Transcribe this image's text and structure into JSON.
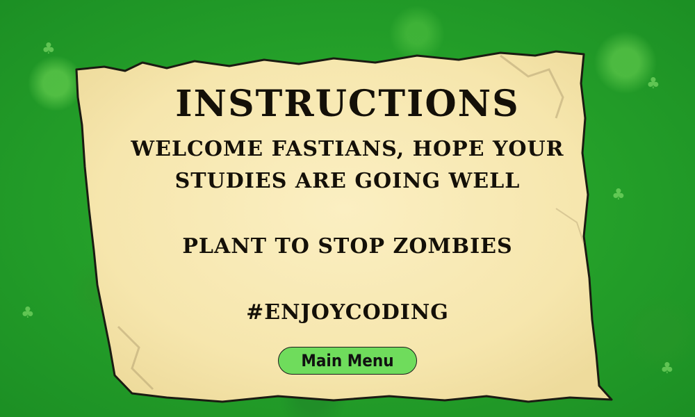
{
  "screen": {
    "title": "INSTRUCTIONS",
    "welcome_line_1": "WELCOME FASTIANS, HOPE YOUR",
    "welcome_line_2": "STUDIES ARE GOING WELL",
    "instruction": "PLANT TO STOP ZOMBIES",
    "hashtag": "#ENJOYCODING"
  },
  "buttons": {
    "main_menu_label": "Main Menu"
  },
  "colors": {
    "background_grass": "#25a22a",
    "parchment": "#f7e9b6",
    "button_fill": "#6fdc5c",
    "text": "#141008"
  }
}
